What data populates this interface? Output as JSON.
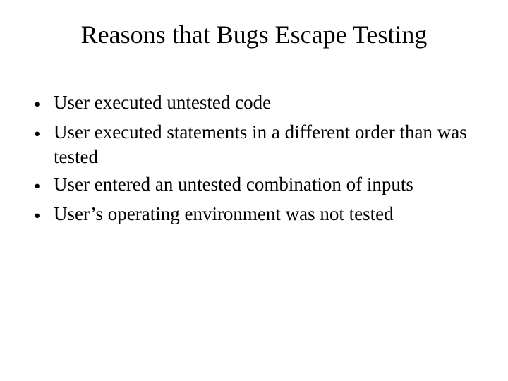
{
  "slide": {
    "title": "Reasons that Bugs Escape Testing",
    "bullets": [
      "User executed untested code",
      "User executed statements in a different order than was tested",
      "User entered an untested combination of inputs",
      "User’s operating environment was not tested"
    ],
    "bullet_char": "•"
  }
}
